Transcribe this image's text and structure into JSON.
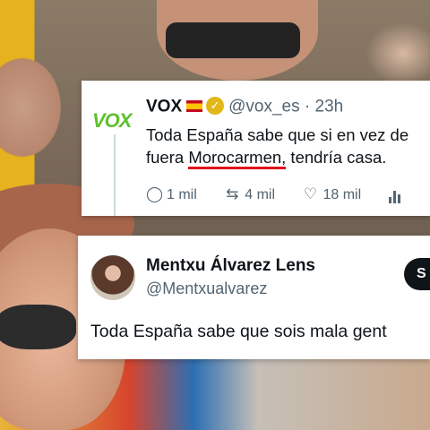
{
  "tweet1": {
    "logo_text": "VOX",
    "name": "VOX",
    "handle": "@vox_es",
    "time": "· 23h",
    "text_line1": "Toda España sabe que si en vez de",
    "text_line2_pre": "fuera ",
    "text_line2_highlight": "Morocarmen,",
    "text_line2_post": " tendría casa.",
    "replies": "1 mil",
    "retweets": "4 mil",
    "likes": "18 mil",
    "underline_color": "#e3121b",
    "verified_color": "#e2b719"
  },
  "tweet2": {
    "name": "Mentxu Álvarez Lens",
    "handle": "@Mentxualvarez",
    "follow_label": "S",
    "text": "Toda España sabe que sois mala gent"
  },
  "icons": [
    "reply-icon",
    "retweet-icon",
    "like-icon",
    "views-icon",
    "verified-icon",
    "spain-flag-icon"
  ]
}
